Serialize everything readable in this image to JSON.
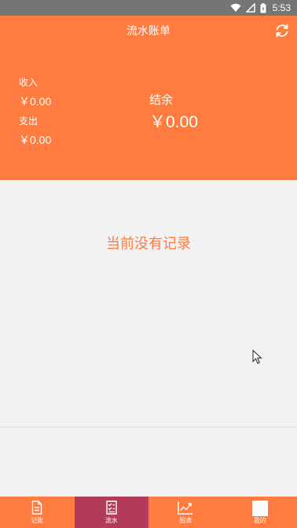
{
  "status_bar": {
    "time": "5:53"
  },
  "header": {
    "title": "流水账单",
    "income_label": "收入",
    "income_amount": "￥0.00",
    "expense_label": "支出",
    "expense_amount": "￥0.00",
    "balance_label": "结余",
    "balance_amount": "￥0.00"
  },
  "main": {
    "empty_text": "当前没有记录"
  },
  "tabs": [
    {
      "label": "记账",
      "icon": "document-icon"
    },
    {
      "label": "流水",
      "icon": "list-icon"
    },
    {
      "label": "图表",
      "icon": "chart-icon"
    },
    {
      "label": "我的",
      "icon": "profile-icon"
    }
  ],
  "colors": {
    "primary": "#ff7b3f",
    "active_tab": "#b13b59",
    "background": "#f2f2f2",
    "status_bar": "#757575"
  }
}
